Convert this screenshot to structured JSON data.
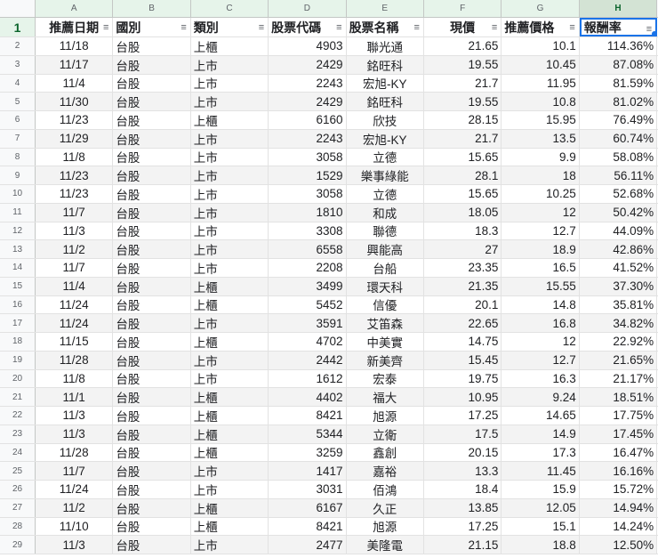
{
  "columns": [
    "A",
    "B",
    "C",
    "D",
    "E",
    "F",
    "G",
    "H"
  ],
  "headers": [
    "推薦日期",
    "國別",
    "類別",
    "股票代碼",
    "股票名稱",
    "現價",
    "推薦價格",
    "報酬率"
  ],
  "rows": [
    [
      "11/18",
      "台股",
      "上櫃",
      "4903",
      "聯光通",
      "21.65",
      "10.1",
      "114.36%"
    ],
    [
      "11/17",
      "台股",
      "上市",
      "2429",
      "銘旺科",
      "19.55",
      "10.45",
      "87.08%"
    ],
    [
      "11/4",
      "台股",
      "上市",
      "2243",
      "宏旭-KY",
      "21.7",
      "11.95",
      "81.59%"
    ],
    [
      "11/30",
      "台股",
      "上市",
      "2429",
      "銘旺科",
      "19.55",
      "10.8",
      "81.02%"
    ],
    [
      "11/23",
      "台股",
      "上櫃",
      "6160",
      "欣技",
      "28.15",
      "15.95",
      "76.49%"
    ],
    [
      "11/29",
      "台股",
      "上市",
      "2243",
      "宏旭-KY",
      "21.7",
      "13.5",
      "60.74%"
    ],
    [
      "11/8",
      "台股",
      "上市",
      "3058",
      "立德",
      "15.65",
      "9.9",
      "58.08%"
    ],
    [
      "11/23",
      "台股",
      "上市",
      "1529",
      "樂事綠能",
      "28.1",
      "18",
      "56.11%"
    ],
    [
      "11/23",
      "台股",
      "上市",
      "3058",
      "立德",
      "15.65",
      "10.25",
      "52.68%"
    ],
    [
      "11/7",
      "台股",
      "上市",
      "1810",
      "和成",
      "18.05",
      "12",
      "50.42%"
    ],
    [
      "11/3",
      "台股",
      "上市",
      "3308",
      "聯德",
      "18.3",
      "12.7",
      "44.09%"
    ],
    [
      "11/2",
      "台股",
      "上市",
      "6558",
      "興能高",
      "27",
      "18.9",
      "42.86%"
    ],
    [
      "11/7",
      "台股",
      "上市",
      "2208",
      "台船",
      "23.35",
      "16.5",
      "41.52%"
    ],
    [
      "11/4",
      "台股",
      "上櫃",
      "3499",
      "環天科",
      "21.35",
      "15.55",
      "37.30%"
    ],
    [
      "11/24",
      "台股",
      "上櫃",
      "5452",
      "信優",
      "20.1",
      "14.8",
      "35.81%"
    ],
    [
      "11/24",
      "台股",
      "上市",
      "3591",
      "艾笛森",
      "22.65",
      "16.8",
      "34.82%"
    ],
    [
      "11/15",
      "台股",
      "上櫃",
      "4702",
      "中美實",
      "14.75",
      "12",
      "22.92%"
    ],
    [
      "11/28",
      "台股",
      "上市",
      "2442",
      "新美齊",
      "15.45",
      "12.7",
      "21.65%"
    ],
    [
      "11/8",
      "台股",
      "上市",
      "1612",
      "宏泰",
      "19.75",
      "16.3",
      "21.17%"
    ],
    [
      "11/1",
      "台股",
      "上櫃",
      "4402",
      "福大",
      "10.95",
      "9.24",
      "18.51%"
    ],
    [
      "11/3",
      "台股",
      "上櫃",
      "8421",
      "旭源",
      "17.25",
      "14.65",
      "17.75%"
    ],
    [
      "11/3",
      "台股",
      "上櫃",
      "5344",
      "立衛",
      "17.5",
      "14.9",
      "17.45%"
    ],
    [
      "11/28",
      "台股",
      "上櫃",
      "3259",
      "鑫創",
      "20.15",
      "17.3",
      "16.47%"
    ],
    [
      "11/7",
      "台股",
      "上市",
      "1417",
      "嘉裕",
      "13.3",
      "11.45",
      "16.16%"
    ],
    [
      "11/24",
      "台股",
      "上市",
      "3031",
      "佰鴻",
      "18.4",
      "15.9",
      "15.72%"
    ],
    [
      "11/2",
      "台股",
      "上櫃",
      "6167",
      "久正",
      "13.85",
      "12.05",
      "14.94%"
    ],
    [
      "11/10",
      "台股",
      "上櫃",
      "8421",
      "旭源",
      "17.25",
      "15.1",
      "14.24%"
    ],
    [
      "11/3",
      "台股",
      "上市",
      "2477",
      "美隆電",
      "21.15",
      "18.8",
      "12.50%"
    ]
  ],
  "filter_icon": "filter-icon",
  "colors": {
    "selection": "#1a73e8",
    "header_bg": "#e6f4ea",
    "stripe": "#f3f3f3"
  }
}
